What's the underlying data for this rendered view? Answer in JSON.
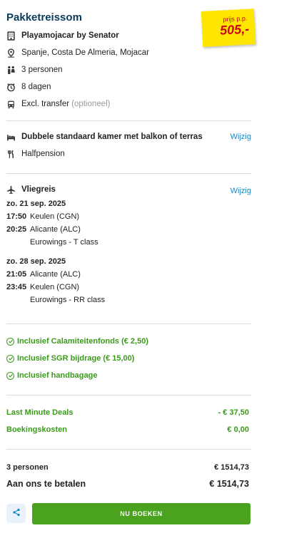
{
  "header": {
    "title": "Pakketreissom",
    "price_label": "prijs p.p.",
    "price_value": "505,-"
  },
  "hotel": {
    "name": "Playamojacar by Senator",
    "location": "Spanje, Costa De Almeria, Mojacar",
    "persons": "3 personen",
    "duration": "8 dagen",
    "transfer": "Excl. transfer",
    "transfer_note": "(optioneel)"
  },
  "room": {
    "type": "Dubbele standaard kamer met balkon of terras",
    "board": "Halfpension",
    "change_label": "Wijzig"
  },
  "flight": {
    "title": "Vliegreis",
    "change_label": "Wijzig",
    "outbound": {
      "date": "zo. 21 sep. 2025",
      "dep_time": "17:50",
      "dep_place": "Keulen (CGN)",
      "arr_time": "20:25",
      "arr_place": "Alicante (ALC)",
      "carrier": "Eurowings - T class"
    },
    "return": {
      "date": "zo. 28 sep. 2025",
      "dep_time": "21:05",
      "dep_place": "Alicante (ALC)",
      "arr_time": "23:45",
      "arr_place": "Keulen (CGN)",
      "carrier": "Eurowings - RR class"
    }
  },
  "inclusions": [
    "Inclusief Calamiteitenfonds (€ 2,50)",
    "Inclusief SGR bijdrage (€ 15,00)",
    "Inclusief handbagage"
  ],
  "costs": {
    "deal_label": "Last Minute Deals",
    "deal_value": "- € 37,50",
    "booking_label": "Boekingskosten",
    "booking_value": "€ 0,00"
  },
  "totals": {
    "persons_label": "3 personen",
    "persons_value": "€ 1514,73",
    "pay_label": "Aan ons te betalen",
    "pay_value": "€ 1514,73"
  },
  "actions": {
    "book_label": "NU BOEKEN"
  },
  "colors": {
    "title": "#0b3a5c",
    "link": "#1a86c8",
    "green": "#3a9a1a",
    "button": "#4aa21e",
    "price_tag": "#ffe600",
    "price_text": "#d0021b"
  },
  "icons": [
    "building-icon",
    "location-pin-icon",
    "persons-icon",
    "clock-icon",
    "bus-icon",
    "bed-icon",
    "cutlery-icon",
    "airplane-icon",
    "check-circle-icon",
    "share-icon"
  ]
}
